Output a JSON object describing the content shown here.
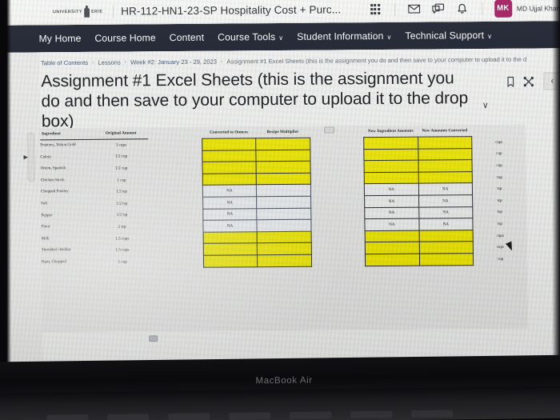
{
  "device": {
    "brand": "MacBook Air"
  },
  "minibar": {
    "logo_text": "UNIVERSITY",
    "logo_text2": "ERIE",
    "course_title": "HR-112-HN1-23-SP Hospitality Cost + Purc...",
    "icons": {
      "waffle": "apps-grid-icon",
      "mail": "mail-icon",
      "chat": "chat-icon",
      "bell": "notification-bell-icon"
    },
    "user": {
      "initials": "MK",
      "name": "MD Ujjal Khan"
    }
  },
  "nav": {
    "items": [
      {
        "label": "My Home",
        "caret": false
      },
      {
        "label": "Course Home",
        "caret": false
      },
      {
        "label": "Content",
        "caret": false
      },
      {
        "label": "Course Tools",
        "caret": true
      },
      {
        "label": "Student Information",
        "caret": true
      },
      {
        "label": "Technical Support",
        "caret": true
      }
    ],
    "caret_glyph": "∨"
  },
  "breadcrumb": {
    "items": [
      "Table of Contents",
      "Lessons",
      "Week #2: January 23 - 29, 2023",
      "Assignment #1 Excel Sheets (this is the assignment you do and then save to your computer to upload it to the d"
    ],
    "separator": "›"
  },
  "page": {
    "title": "Assignment #1 Excel Sheets (this is the assignment you do and then save to your computer to upload it to the drop box)",
    "title_caret": "∨",
    "tools": {
      "bookmark": "bookmark-icon",
      "expand": "expand-fullscreen-icon",
      "back": "‹"
    }
  },
  "worksheet": {
    "headers": {
      "ingredient": "Ingredient",
      "original_amount": "Original Amount",
      "converted_to_ounces": "Converted to Ounces",
      "recipe_multiplier": "Recipe Multiplier",
      "new_ingredient_amounts": "New Ingredient Amounts",
      "new_amounts_converted": "New Amounts Converted"
    },
    "rows": [
      {
        "ingredient": "Potatoes, Yukon Gold",
        "amount": "3 cups",
        "ounces": "",
        "multiplier": "",
        "new_amount": "",
        "new_converted": "",
        "unit": "cups",
        "fill": "yellow"
      },
      {
        "ingredient": "Celery",
        "amount": "1/2 cup",
        "ounces": "",
        "multiplier": "",
        "new_amount": "",
        "new_converted": "",
        "unit": "cup",
        "fill": "yellow"
      },
      {
        "ingredient": "Onion, Spanish",
        "amount": "1/2 cup",
        "ounces": "",
        "multiplier": "",
        "new_amount": "",
        "new_converted": "",
        "unit": "cup",
        "fill": "yellow"
      },
      {
        "ingredient": "Chicken Stock",
        "amount": "1 cup",
        "ounces": "",
        "multiplier": "",
        "new_amount": "",
        "new_converted": "",
        "unit": "cup",
        "fill": "yellow"
      },
      {
        "ingredient": "Chopped Parsley",
        "amount": "1.5 tsp",
        "ounces": "NA",
        "multiplier": "",
        "new_amount": "NA",
        "new_converted": "NA",
        "unit": "tsp",
        "fill": "white"
      },
      {
        "ingredient": "Salt",
        "amount": "1/2 tsp",
        "ounces": "NA",
        "multiplier": "",
        "new_amount": "NA",
        "new_converted": "NA",
        "unit": "tsp",
        "fill": "white"
      },
      {
        "ingredient": "Pepper",
        "amount": "1/2 tsp",
        "ounces": "NA",
        "multiplier": "",
        "new_amount": "NA",
        "new_converted": "NA",
        "unit": "tsp",
        "fill": "white"
      },
      {
        "ingredient": "Flour",
        "amount": "2 tsp",
        "ounces": "NA",
        "multiplier": "",
        "new_amount": "NA",
        "new_converted": "NA",
        "unit": "tsp",
        "fill": "white"
      },
      {
        "ingredient": "Milk",
        "amount": "1.5 cups",
        "ounces": "",
        "multiplier": "",
        "new_amount": "",
        "new_converted": "",
        "unit": "cups",
        "fill": "yellow"
      },
      {
        "ingredient": "Shredded cheddar",
        "amount": "1.5 cups",
        "ounces": "",
        "multiplier": "",
        "new_amount": "",
        "new_converted": "",
        "unit": "cups",
        "fill": "yellow"
      },
      {
        "ingredient": "Ham, Chopped",
        "amount": "1 cup",
        "ounces": "",
        "multiplier": "",
        "new_amount": "",
        "new_converted": "",
        "unit": "cup",
        "fill": "yellow"
      }
    ]
  },
  "colors": {
    "nav_bg": "#151a28",
    "cell_fill": "#f2ea08",
    "avatar_bg": "#a4125a"
  }
}
